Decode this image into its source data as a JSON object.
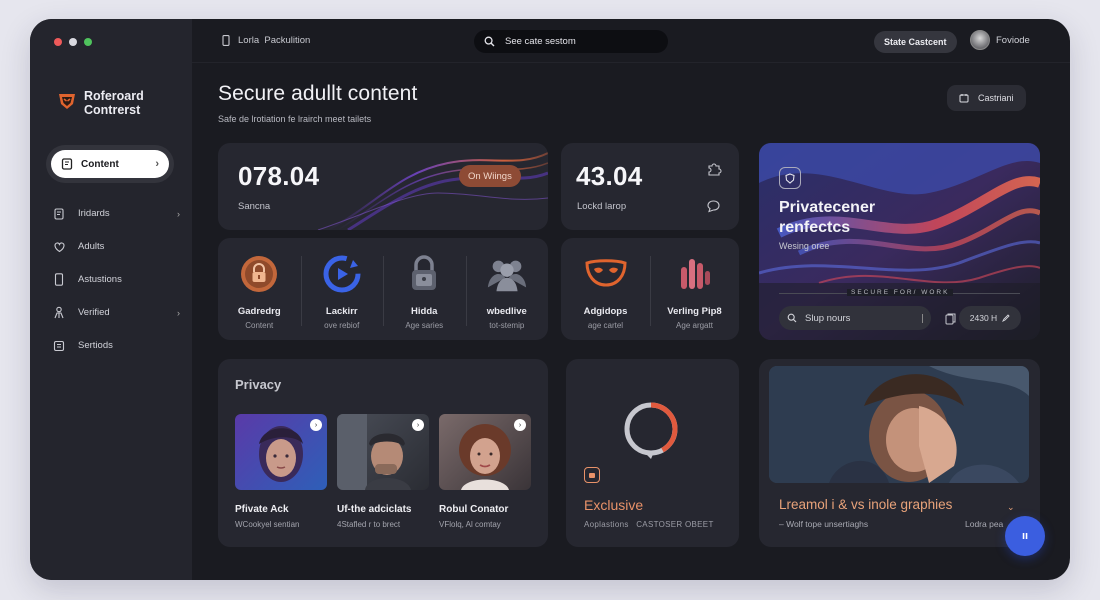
{
  "window": {
    "traffic_colors": [
      "#ee5a5a",
      "#d9d9e0",
      "#4fc35d"
    ]
  },
  "brand": {
    "name": "Roferoard Contrerst"
  },
  "sidebar": {
    "active_item": {
      "label": "Content",
      "icon": "document-icon"
    },
    "items": [
      {
        "label": "Iridards",
        "icon": "document-icon",
        "has_chevron": true
      },
      {
        "label": "Adults",
        "icon": "heart-icon",
        "has_chevron": false
      },
      {
        "label": "Astustions",
        "icon": "phone-icon",
        "has_chevron": false
      },
      {
        "label": "Verified",
        "icon": "user-icon",
        "has_chevron": true
      },
      {
        "label": "Sertiods",
        "icon": "settings-icon",
        "has_chevron": false
      }
    ]
  },
  "topbar": {
    "left_label": "Lorla  Packulition",
    "search_text": "See cate sestom",
    "state_button": "State Castcent",
    "profile_name": "Foviode"
  },
  "header": {
    "title": "Secure adullt content",
    "subtitle": "Safe de lrotiation fe lrairch meet tailets",
    "calendar_label": "Castriani"
  },
  "stat1": {
    "value": "078.04",
    "label": "Sancna",
    "badge": "On Wiings"
  },
  "stat2": {
    "value": "43.04",
    "label": "Lockd larop"
  },
  "features_left": [
    {
      "title": "Gadredrg",
      "sub": "Content",
      "icon": "lock-icon"
    },
    {
      "title": "Lackirr",
      "sub": "ove rebiof",
      "icon": "refresh-icon"
    },
    {
      "title": "Hidda",
      "sub": "Age saries",
      "icon": "padlock-icon"
    },
    {
      "title": "wbedlive",
      "sub": "tot-stemip",
      "icon": "group-icon"
    }
  ],
  "features_right": [
    {
      "title": "Adgidops",
      "sub": "age cartel",
      "icon": "mask-icon"
    },
    {
      "title": "Verling Pip8",
      "sub": "Age argatt",
      "icon": "bars-icon"
    }
  ],
  "hero": {
    "title": "Privatecener renfectcs",
    "subtitle": "Wesing oree",
    "caption": "SECURE  FOR/  WORK",
    "search_label": "Slup nours",
    "stat_label": "2430 H"
  },
  "privacy": {
    "title": "Privacy",
    "people": [
      {
        "name": "Pfivate Ack",
        "sub": "WCookyel sentian"
      },
      {
        "name": "Uf-the adciclats",
        "sub": "4Stafled r to brect"
      },
      {
        "name": "Robul Conator",
        "sub": "VFlolq, Al comtay"
      }
    ]
  },
  "exclusive": {
    "title": "Exclusive",
    "sub": "Aoplastions   CASTOSER OBEET",
    "progress_percent": 42
  },
  "featured": {
    "title": "Lreamol i & vs inole graphies",
    "sub": "– Wolf tope unsertiaghs",
    "read_label": "Lodra pea"
  },
  "fab": {
    "label": "ıı"
  }
}
